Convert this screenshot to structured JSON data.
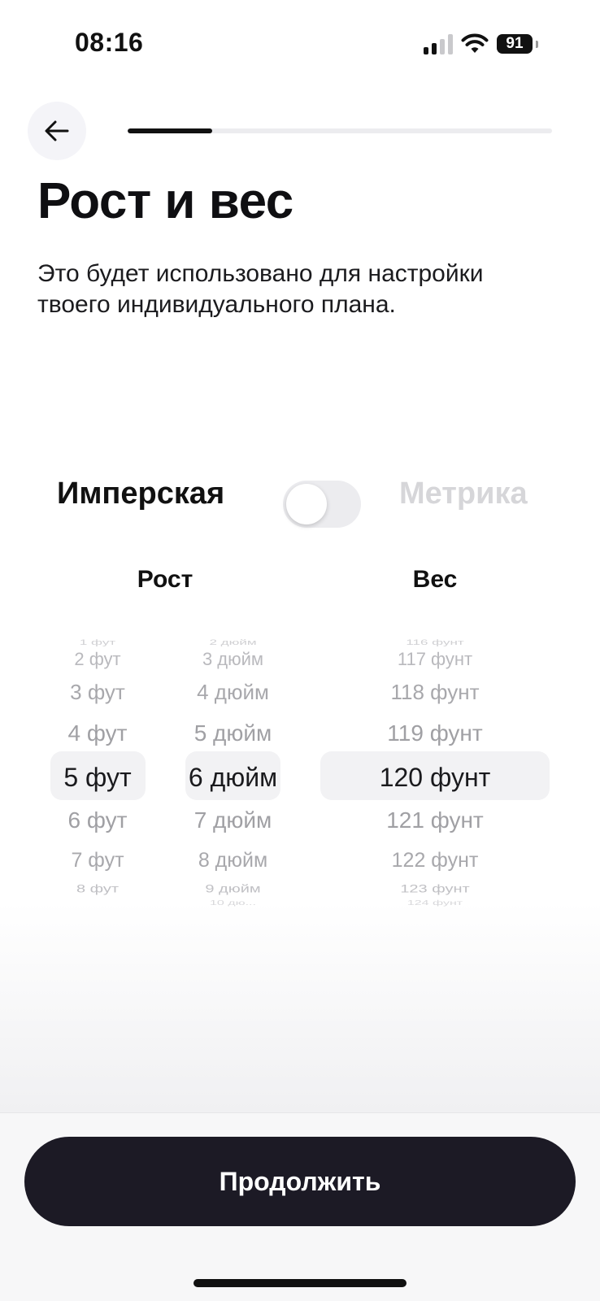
{
  "status_bar": {
    "time": "08:16",
    "battery": "91",
    "icons": [
      "signal-icon",
      "wifi-icon",
      "battery-icon"
    ]
  },
  "header": {
    "back_icon": "arrow-left-icon",
    "progress_fraction": 0.2
  },
  "title": "Рост и вес",
  "subtitle": "Это будет использовано для настройки твоего индивидуального плана.",
  "units": {
    "imperial_label": "Имперская",
    "metric_label": "Метрика",
    "metric_enabled": false
  },
  "columns": {
    "height_label": "Рост",
    "weight_label": "Вес"
  },
  "pickers": {
    "feet": [
      "1 фут",
      "2 фут",
      "3 фут",
      "4 фут",
      "5 фут",
      "6 фут",
      "7 фут",
      "8 фут",
      ""
    ],
    "inches": [
      "2 дюйм",
      "3 дюйм",
      "4 дюйм",
      "5 дюйм",
      "6 дюйм",
      "7 дюйм",
      "8 дюйм",
      "9 дюйм",
      "10 дю..."
    ],
    "pounds": [
      "116 фунт",
      "117 фунт",
      "118 фунт",
      "119 фунт",
      "120 фунт",
      "121 фунт",
      "122 фунт",
      "123 фунт",
      "124 фунт"
    ],
    "selected": {
      "feet": "5 фут",
      "inches": "6 дюйм",
      "pounds": "120 фунт"
    }
  },
  "continue_label": "Продолжить"
}
